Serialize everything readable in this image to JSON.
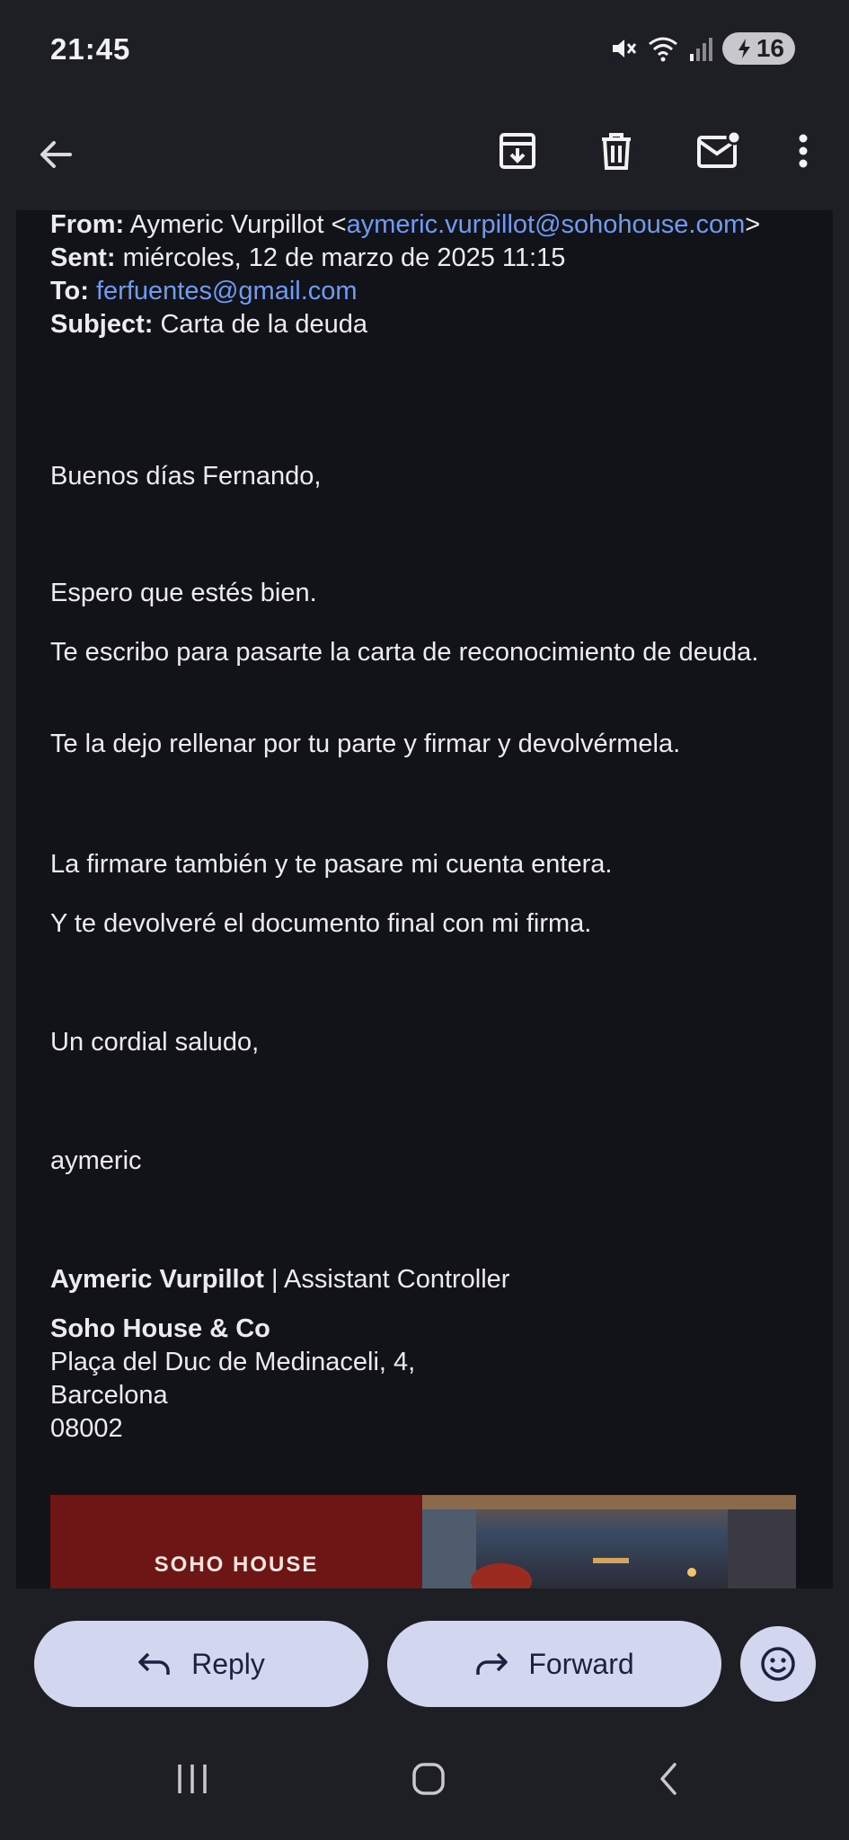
{
  "status": {
    "time": "21:45",
    "battery": "16",
    "icons": [
      "mute-icon",
      "wifi-icon",
      "signal-icon",
      "battery-icon"
    ]
  },
  "toolbar": {
    "icons": [
      "back-arrow-icon",
      "archive-icon",
      "delete-icon",
      "mark-unread-icon",
      "more-vert-icon"
    ]
  },
  "email": {
    "from_label": "From:",
    "from_name": "Aymeric Vurpillot <",
    "from_email": "aymeric.vurpillot@sohohouse.com",
    "from_close": ">",
    "sent_label": "Sent:",
    "sent_value": "miércoles, 12 de marzo de 2025 11:15",
    "to_label": "To:",
    "to_value": "ferfuentes@gmail.com",
    "subject_label": "Subject:",
    "subject_value": "Carta de la deuda",
    "body": [
      "Buenos días Fernando,",
      "Espero que estés bien.",
      "Te escribo para pasarte la carta de reconocimiento de deuda.",
      "Te la dejo rellenar por tu parte y firmar y devolvérmela.",
      "La firmare también y te pasare mi cuenta entera.",
      "Y te devolveré el documento final con mi firma.",
      "Un cordial saludo,",
      "aymeric"
    ],
    "signature": {
      "name": "Aymeric Vurpillot",
      "separator": " | ",
      "role": "Assistant Controller",
      "company": "Soho House & Co",
      "address1": "Plaça del Duc de Medinaceli, 4,",
      "address2": "Barcelona",
      "postcode": "08002"
    },
    "banner_text": "SOHO HOUSE"
  },
  "actions": {
    "reply_label": "Reply",
    "forward_label": "Forward"
  },
  "colors": {
    "background": "#1e1f24",
    "content": "#121319",
    "link": "#6f9bf2",
    "pill": "#d3d6ef",
    "banner": "#6d1615"
  }
}
